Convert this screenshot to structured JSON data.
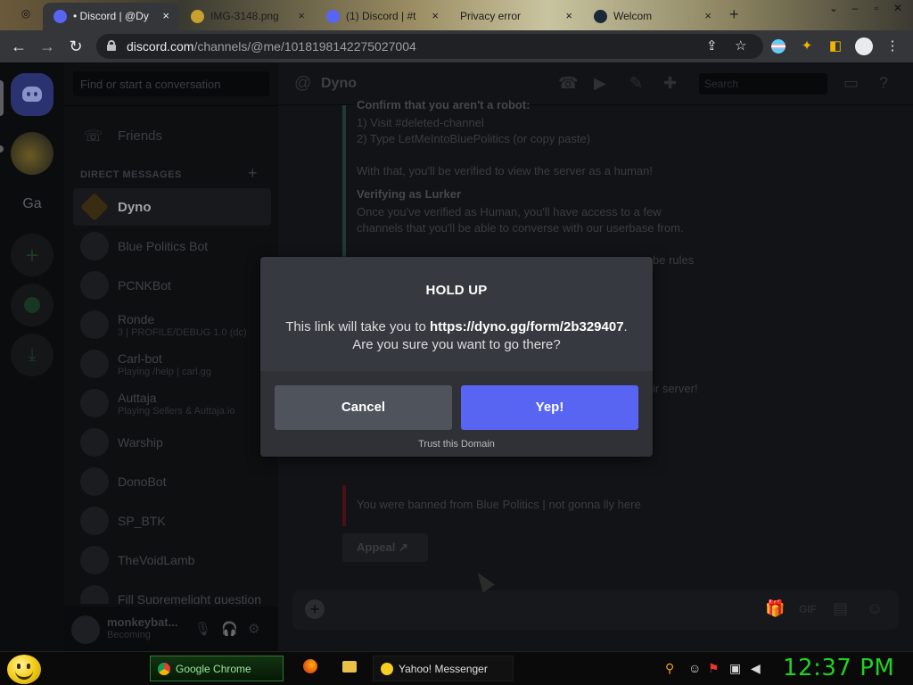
{
  "browser": {
    "tabs": [
      {
        "label": "• Discord | @Dy",
        "close": "×",
        "active": true
      },
      {
        "label": "IMG-3148.png",
        "close": "×",
        "active": false
      },
      {
        "label": "(1) Discord | #t",
        "close": "×",
        "active": false
      },
      {
        "label": "Privacy error",
        "close": "×",
        "active": false
      },
      {
        "label": "Welcom",
        "close": "×",
        "active": false
      }
    ],
    "new_tab": "+",
    "url_host": "discord.com",
    "url_path": "/channels/@me/1018198142275027004"
  },
  "discord": {
    "guild_text": "Ga",
    "dm_search_placeholder": "Find or start a conversation",
    "friends_label": "Friends",
    "dm_header": "DIRECT MESSAGES",
    "dm_add": "+",
    "dms": [
      {
        "name": "Dyno",
        "sub": ""
      },
      {
        "name": "Blue Politics Bot",
        "sub": ""
      },
      {
        "name": "PCNKBot",
        "sub": ""
      },
      {
        "name": "Ronde",
        "sub": "3 | PROFILE/DEBUG 1.0 (dc)"
      },
      {
        "name": "Carl-bot",
        "sub": "Playing /help | carl.gg"
      },
      {
        "name": "Auttaja",
        "sub": "Playing Sellers & Auttaja.io"
      },
      {
        "name": "Warship",
        "sub": ""
      },
      {
        "name": "DonoBot",
        "sub": ""
      },
      {
        "name": "SP_BTK",
        "sub": ""
      },
      {
        "name": "TheVoidLamb",
        "sub": ""
      },
      {
        "name": "Fill Supremelight question",
        "sub": ""
      }
    ],
    "user": {
      "name": "monkeybat...",
      "status": "Becoming"
    },
    "channel_name": "Dyno",
    "chat_search": "Search",
    "messages": [
      {
        "text": "Confirm that you aren't a robot:",
        "bold": true
      },
      {
        "text": "1) Visit #deleted-channel",
        "bold": false
      },
      {
        "text": "2) Type LetMeIntoBluePolitics (or copy paste)",
        "bold": false
      },
      {
        "text": "With that, you'll be verified to view the server as a human!",
        "bold": false
      },
      {
        "text": "Verifying as Lurker",
        "bold": true
      },
      {
        "text": "Once you've verified as Human, you'll have access to a few",
        "bold": false
      },
      {
        "text": "channels that you'll be able to converse with our userbase from.",
        "bold": false
      },
      {
        "text": "be rules",
        "bold": false
      },
      {
        "text": "ir server!",
        "bold": false
      },
      {
        "text": "You were banned from Blue Politics | not gonna lly here",
        "bold": false
      }
    ],
    "appeal_label": "Appeal ↗"
  },
  "modal": {
    "title": "HOLD UP",
    "body_prefix": "This link will take you to ",
    "link": "https://dyno.gg/form/2b329407",
    "body_suffix": ".",
    "question": "Are you sure you want to go there?",
    "cancel_label": "Cancel",
    "confirm_label": "Yep!",
    "trust_label": "Trust this Domain"
  },
  "taskbar": {
    "tasks": [
      {
        "label": "Google Chrome"
      },
      {
        "label": "Yahoo! Messenger"
      }
    ],
    "clock": "12:37 PM"
  },
  "colors": {
    "blurple": "#5865f2",
    "modal_bg": "#36393f",
    "modal_footer": "#2f3136",
    "cancel_bg": "#4f545c",
    "clock_green": "#22d022"
  }
}
